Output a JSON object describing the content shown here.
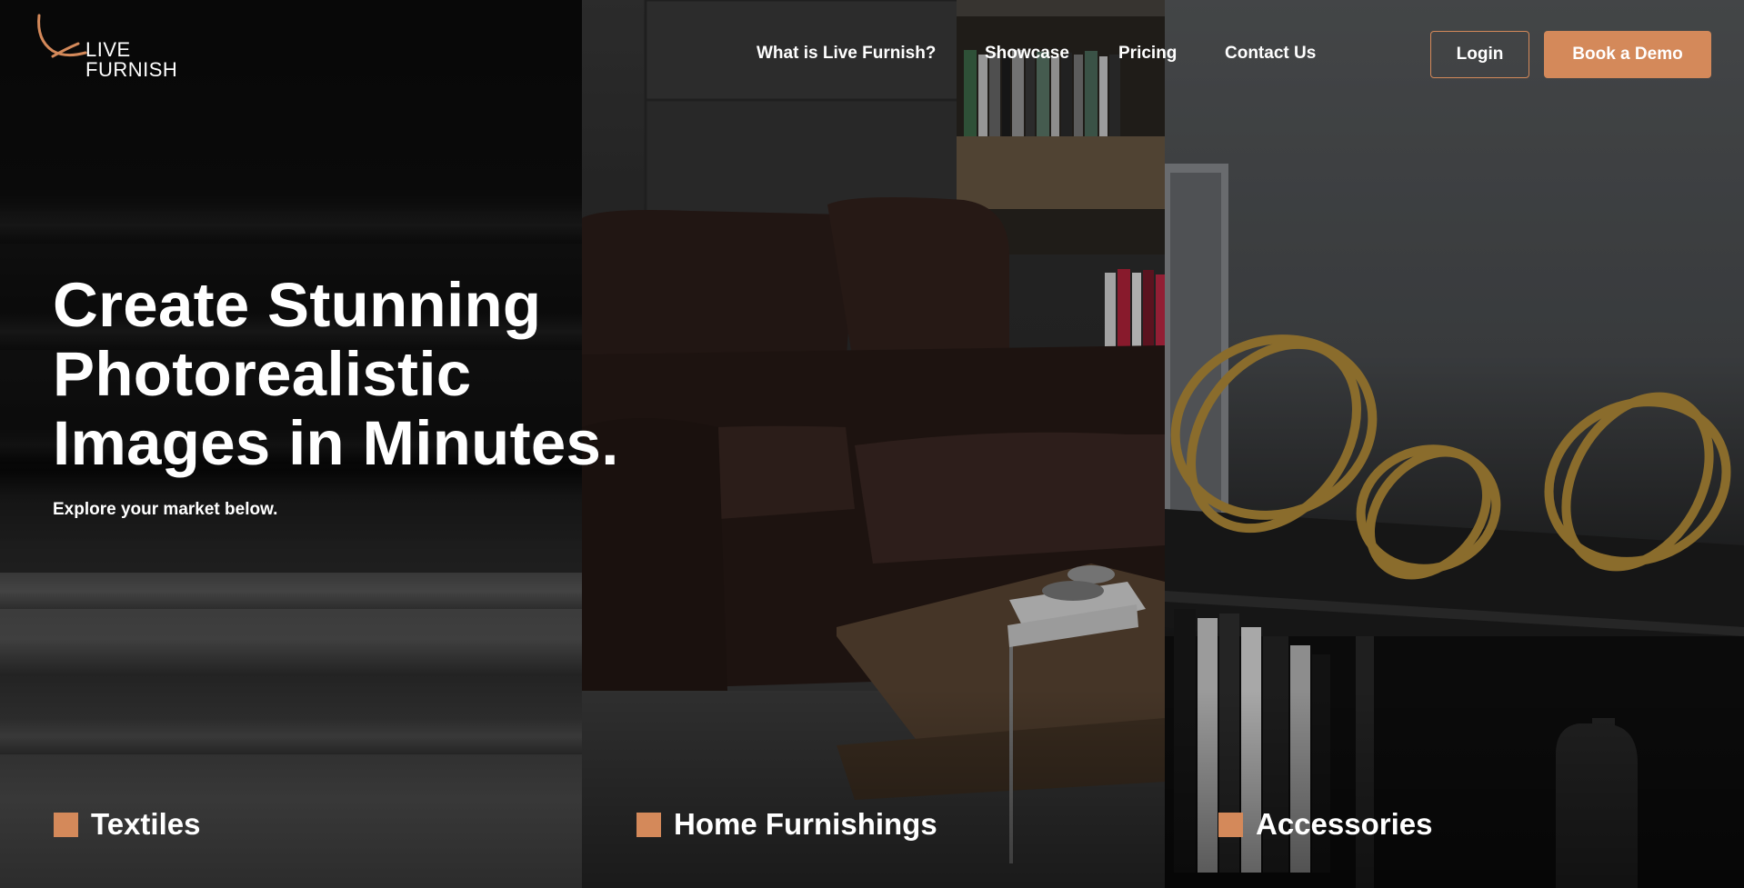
{
  "brand": {
    "logo_text": "LIVE FURNISH",
    "accent_color": "#d4895a"
  },
  "nav": {
    "items": [
      {
        "label": "What is Live Furnish?"
      },
      {
        "label": "Showcase"
      },
      {
        "label": "Pricing"
      },
      {
        "label": "Contact Us"
      }
    ],
    "login_label": "Login",
    "demo_label": "Book a Demo"
  },
  "hero": {
    "title": "Create Stunning Photorealistic Images in Minutes.",
    "subtitle": "Explore your market below."
  },
  "categories": [
    {
      "label": "Textiles"
    },
    {
      "label": "Home Furnishings"
    },
    {
      "label": "Accessories"
    }
  ]
}
